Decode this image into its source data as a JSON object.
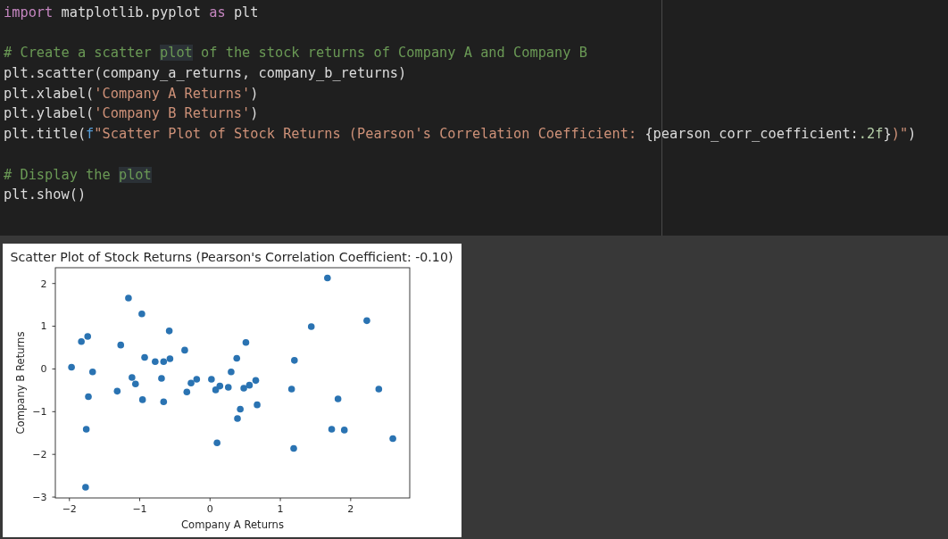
{
  "editor": {
    "blocks": [
      {
        "lines": [
          {
            "tokens": [
              {
                "text": "import",
                "kind": "keyword",
                "highlighted": false
              },
              {
                "text": " matplotlib.pyplot ",
                "kind": "plain",
                "highlighted": false
              },
              {
                "text": "as",
                "kind": "keyword",
                "highlighted": false
              },
              {
                "text": " plt",
                "kind": "plain",
                "highlighted": false
              }
            ]
          }
        ]
      },
      {
        "lines": [
          {
            "tokens": [
              {
                "text": "# Create a scatter ",
                "kind": "comment",
                "highlighted": false
              },
              {
                "text": "plot",
                "kind": "comment",
                "highlighted": true
              },
              {
                "text": " of the stock returns of Company A and Company B",
                "kind": "comment",
                "highlighted": false
              }
            ]
          },
          {
            "tokens": [
              {
                "text": "plt.scatter(company_a_returns, company_b_returns)",
                "kind": "plain",
                "highlighted": false
              }
            ]
          },
          {
            "tokens": [
              {
                "text": "plt.xlabel(",
                "kind": "plain",
                "highlighted": false
              },
              {
                "text": "'Company A Returns'",
                "kind": "string",
                "highlighted": false
              },
              {
                "text": ")",
                "kind": "plain",
                "highlighted": false
              }
            ]
          },
          {
            "tokens": [
              {
                "text": "plt.ylabel(",
                "kind": "plain",
                "highlighted": false
              },
              {
                "text": "'Company B Returns'",
                "kind": "string",
                "highlighted": false
              },
              {
                "text": ")",
                "kind": "plain",
                "highlighted": false
              }
            ]
          },
          {
            "tokens": [
              {
                "text": "plt.title(",
                "kind": "plain",
                "highlighted": false
              },
              {
                "text": "f",
                "kind": "prefix",
                "highlighted": false
              },
              {
                "text": "\"Scatter Plot of Stock Returns (Pearson's Correlation Coefficient: ",
                "kind": "string",
                "highlighted": false
              },
              {
                "text": "{pearson_corr_coefficient:",
                "kind": "plain",
                "highlighted": false
              },
              {
                "text": ".2f",
                "kind": "spec",
                "highlighted": false
              },
              {
                "text": "}",
                "kind": "plain",
                "highlighted": false
              },
              {
                "text": ")\"",
                "kind": "string",
                "highlighted": false
              },
              {
                "text": ")",
                "kind": "plain",
                "highlighted": false
              }
            ]
          }
        ]
      },
      {
        "lines": [
          {
            "tokens": [
              {
                "text": "# Display the ",
                "kind": "comment",
                "highlighted": false
              },
              {
                "text": "plot",
                "kind": "comment",
                "highlighted": true
              }
            ]
          },
          {
            "tokens": [
              {
                "text": "plt.show()",
                "kind": "plain",
                "highlighted": false
              }
            ]
          }
        ]
      }
    ]
  },
  "output": {
    "figure": {
      "chart_data": {
        "type": "scatter",
        "title": "Scatter Plot of Stock Returns (Pearson's Correlation Coefficient: -0.10)",
        "xlabel": "Company A Returns",
        "ylabel": "Company B Returns",
        "x": [
          -1.97,
          -1.83,
          -1.74,
          -1.67,
          -1.73,
          -1.76,
          -1.77,
          -1.27,
          -1.32,
          -1.16,
          -0.97,
          -0.93,
          -1.11,
          -1.06,
          -0.96,
          -0.78,
          -0.66,
          -0.57,
          -0.58,
          -0.69,
          -0.66,
          -0.36,
          -0.27,
          -0.19,
          -0.33,
          0.02,
          0.08,
          0.14,
          0.1,
          0.26,
          0.3,
          0.38,
          0.39,
          0.43,
          1.67,
          2.23,
          1.44,
          0.51,
          1.2,
          0.65,
          0.56,
          0.48,
          1.16,
          2.4,
          1.82,
          0.67,
          1.73,
          1.91,
          2.6,
          1.19
        ],
        "values": [
          0.04,
          0.64,
          0.76,
          -0.07,
          -0.65,
          -1.41,
          -2.77,
          0.56,
          -0.52,
          1.66,
          1.29,
          0.27,
          -0.2,
          -0.35,
          -0.72,
          0.17,
          0.17,
          0.24,
          0.89,
          -0.22,
          -0.77,
          0.44,
          -0.33,
          -0.24,
          -0.54,
          -0.24,
          -0.49,
          -0.4,
          -1.73,
          -0.43,
          -0.07,
          0.25,
          -1.16,
          -0.94,
          2.13,
          1.13,
          0.99,
          0.62,
          0.2,
          -0.27,
          -0.38,
          -0.45,
          -0.47,
          -0.47,
          -0.7,
          -0.84,
          -1.41,
          -1.43,
          -1.63,
          -1.86
        ],
        "xlim": [
          -2.2,
          2.84
        ],
        "ylim": [
          -3.02,
          2.37
        ],
        "xticks": [
          {
            "value": -2,
            "label": "−2"
          },
          {
            "value": -1,
            "label": "−1"
          },
          {
            "value": 0,
            "label": "0"
          },
          {
            "value": 1,
            "label": "1"
          },
          {
            "value": 2,
            "label": "2"
          }
        ],
        "yticks": [
          {
            "value": -3,
            "label": "−3"
          },
          {
            "value": -2,
            "label": "−2"
          },
          {
            "value": -1,
            "label": "−1"
          },
          {
            "value": 0,
            "label": "0"
          },
          {
            "value": 1,
            "label": "1"
          },
          {
            "value": 2,
            "label": "2"
          }
        ]
      }
    }
  }
}
